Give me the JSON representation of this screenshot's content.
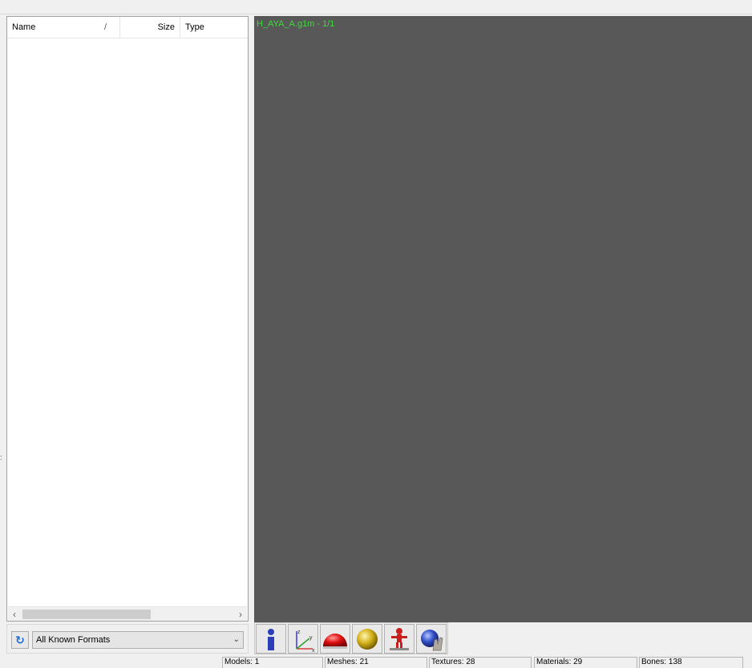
{
  "file_list": {
    "columns": {
      "name": "Name",
      "sort_indicator": "/",
      "size": "Size",
      "type": "Type"
    }
  },
  "format_filter": {
    "selected": "All Known Formats"
  },
  "viewport": {
    "label": "H_AYA_A.g1m - 1/1"
  },
  "toolbar": {
    "buttons": [
      "info-icon",
      "axes-icon",
      "red-dome-icon",
      "gold-sphere-icon",
      "bone-figure-icon",
      "globe-hand-icon"
    ]
  },
  "status": {
    "models": "Models: 1",
    "meshes": "Meshes: 21",
    "textures": "Textures: 28",
    "materials": "Materials: 29",
    "bones": "Bones: 138"
  },
  "colors": {
    "viewport_bg": "#585858",
    "label_green": "#3fd93f"
  }
}
